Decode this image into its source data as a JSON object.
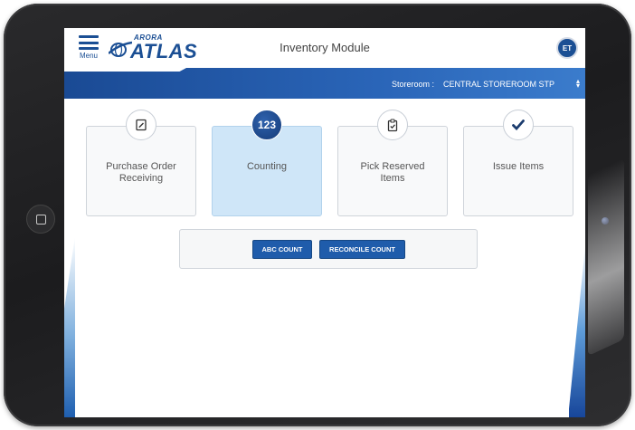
{
  "header": {
    "menu_label": "Menu",
    "logo_small": "ARORA",
    "logo_big": "ATLAS",
    "title": "Inventory Module",
    "avatar_initials": "ET"
  },
  "storeroom": {
    "label": "Storeroom :",
    "value": "CENTRAL STOREROOM STP"
  },
  "tiles": [
    {
      "label": "Purchase Order Receiving",
      "icon": "clipboard-edit-icon",
      "active": false
    },
    {
      "label": "Counting",
      "icon": "count-123-icon",
      "icon_text": "123",
      "active": true
    },
    {
      "label": "Pick Reserved Items",
      "icon": "clipboard-check-icon",
      "active": false
    },
    {
      "label": "Issue Items",
      "icon": "checkmark-icon",
      "active": false
    }
  ],
  "count_actions": {
    "abc_count": "ABC COUNT",
    "reconcile_count": "RECONCILE COUNT"
  },
  "colors": {
    "brand_blue": "#1b4f94",
    "active_tile": "#cfe6f8",
    "button_blue": "#1f5cab"
  }
}
